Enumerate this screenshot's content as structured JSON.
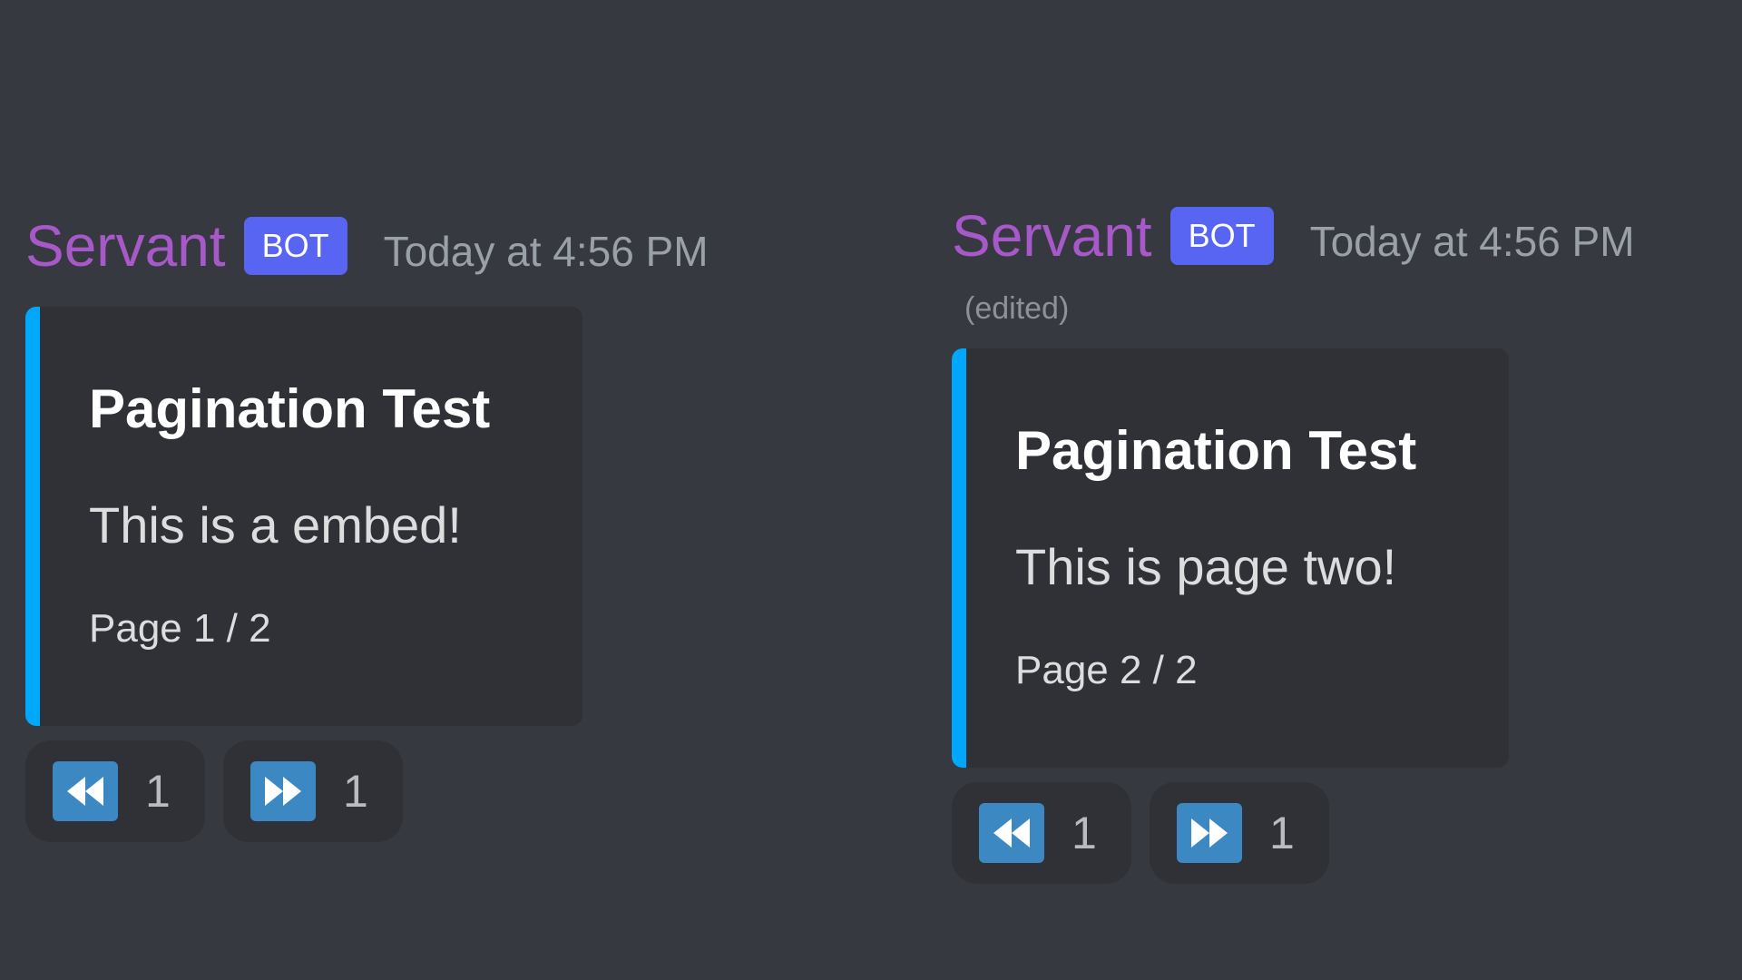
{
  "messages": [
    {
      "author": "Servant",
      "badge": "BOT",
      "timestamp": "Today at 4:56 PM",
      "edited_label": "",
      "embed": {
        "accent_color": "#00a8fc",
        "title": "Pagination Test",
        "description": "This is a embed!",
        "footer": "Page 1 / 2"
      },
      "reactions": [
        {
          "icon": "rewind-icon",
          "count": "1"
        },
        {
          "icon": "fast-forward-icon",
          "count": "1"
        }
      ]
    },
    {
      "author": "Servant",
      "badge": "BOT",
      "timestamp": "Today at 4:56 PM",
      "edited_label": "(edited)",
      "embed": {
        "accent_color": "#00a8fc",
        "title": "Pagination Test",
        "description": "This is page two!",
        "footer": "Page 2 / 2"
      },
      "reactions": [
        {
          "icon": "rewind-icon",
          "count": "1"
        },
        {
          "icon": "fast-forward-icon",
          "count": "1"
        }
      ]
    }
  ],
  "colors": {
    "background": "#36393f",
    "embed_background": "#2f3136",
    "author": "#a859c9",
    "bot_badge": "#5865f2",
    "reaction_icon": "#3b88c3"
  }
}
